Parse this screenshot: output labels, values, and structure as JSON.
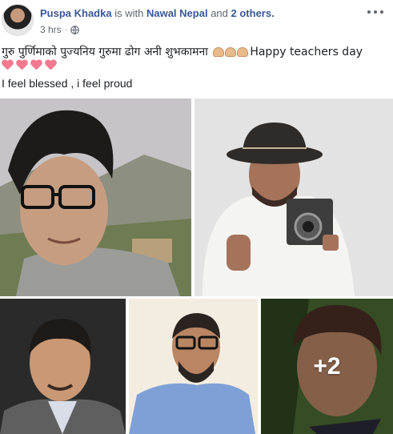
{
  "post": {
    "author": "Puspa Khadka",
    "with_text": "is with",
    "tagged_name": "Nawal Nepal",
    "and_text": "and",
    "others": "2 others.",
    "time": "3 hrs",
    "separator": "·",
    "privacy_icon": "globe-icon",
    "text_line1_before": "गुरु पुर्णिमाको पुज्यनिय गुरुमा ढोग अनी शुभकामना",
    "text_line1_after": "Happy teachers day",
    "emoji_hands": "folded-hands-icon",
    "emoji_hearts": "heart-icon",
    "text_line2": "I feel blessed , i feel proud"
  },
  "photos": {
    "count": 5,
    "more_overlay": "+2"
  },
  "colors": {
    "link": "#385898",
    "meta": "#616770",
    "heart": "#f2798f"
  }
}
